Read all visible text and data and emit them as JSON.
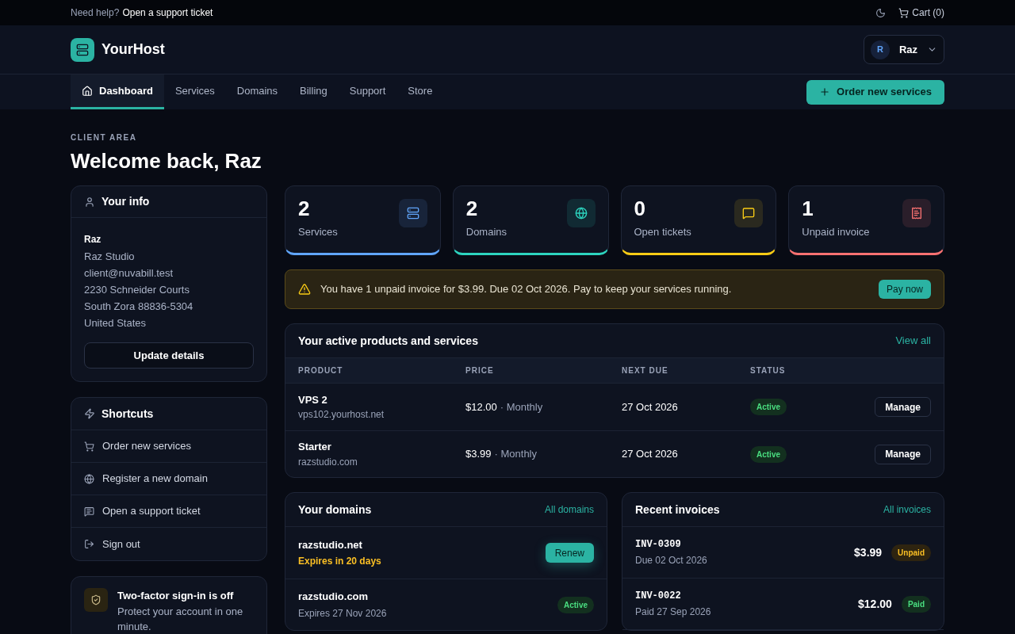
{
  "topbar": {
    "help_text": "Need help?",
    "help_link": "Open a support ticket",
    "cart": "Cart (0)"
  },
  "header": {
    "brand": "YourHost",
    "user": {
      "initial": "R",
      "name": "Raz"
    }
  },
  "nav": {
    "tabs": [
      {
        "label": "Dashboard",
        "selected": true
      },
      {
        "label": "Services",
        "selected": false
      },
      {
        "label": "Domains",
        "selected": false
      },
      {
        "label": "Billing",
        "selected": false
      },
      {
        "label": "Support",
        "selected": false
      },
      {
        "label": "Store",
        "selected": false
      }
    ],
    "order_button": "Order new services"
  },
  "page": {
    "eyebrow": "CLIENT AREA",
    "title": "Welcome back, Raz"
  },
  "info_card": {
    "title": "Your info",
    "name": "Raz",
    "lines": [
      "Raz Studio",
      "client@nuvabill.test",
      "2230 Schneider Courts",
      "South Zora 88836-5304",
      "United States"
    ],
    "button": "Update details"
  },
  "shortcuts": {
    "title": "Shortcuts",
    "items": [
      {
        "kind": "cart",
        "label": "Order new services"
      },
      {
        "kind": "globe",
        "label": "Register a new domain"
      },
      {
        "kind": "chat",
        "label": "Open a support ticket"
      },
      {
        "kind": "signout",
        "label": "Sign out"
      }
    ]
  },
  "security_card": {
    "title": "Two-factor sign-in is off",
    "text": "Protect your account in one minute."
  },
  "stats": [
    {
      "kind": "server",
      "value": "2",
      "label": "Services",
      "color": "#60a5fa"
    },
    {
      "kind": "globe",
      "value": "2",
      "label": "Domains",
      "color": "#2dd4bf"
    },
    {
      "kind": "chat",
      "value": "0",
      "label": "Open tickets",
      "color": "#facc15"
    },
    {
      "kind": "receipt",
      "value": "1",
      "label": "Unpaid invoice",
      "color": "#f87171"
    }
  ],
  "alert": {
    "text": "You have 1 unpaid invoice for $3.99. Due 02 Oct 2026. Pay to keep your services running.",
    "button": "Pay now"
  },
  "products": {
    "title": "Your active products and services",
    "link": "View all",
    "columns": [
      "PRODUCT",
      "PRICE",
      "NEXT DUE",
      "STATUS"
    ],
    "rows": [
      {
        "name": "VPS 2",
        "host": "vps102.yourhost.net",
        "price": "$12.00",
        "cycle": "· Monthly",
        "due": "27 Oct 2026",
        "status": "Active",
        "action": "Manage"
      },
      {
        "name": "Starter",
        "host": "razstudio.com",
        "price": "$3.99",
        "cycle": "· Monthly",
        "due": "27 Oct 2026",
        "status": "Active",
        "action": "Manage"
      }
    ]
  },
  "domains": {
    "title": "Your domains",
    "link": "All domains",
    "rows": [
      {
        "name": "razstudio.net",
        "expiry": "Expires in 20 days",
        "warning": true,
        "kind": "button",
        "action": "Renew"
      },
      {
        "name": "razstudio.com",
        "expiry": "Expires 27 Nov 2026",
        "warning": false,
        "kind": "badge",
        "action": "Active"
      }
    ]
  },
  "invoices": {
    "title": "Recent invoices",
    "link": "All invoices",
    "rows": [
      {
        "number": "INV-0309",
        "date": "Due 02 Oct 2026",
        "amount": "$3.99",
        "status": "Unpaid",
        "kind": "unpaid"
      },
      {
        "number": "INV-0022",
        "date": "Paid 27 Sep 2026",
        "amount": "$12.00",
        "status": "Paid",
        "kind": "paid"
      }
    ]
  }
}
